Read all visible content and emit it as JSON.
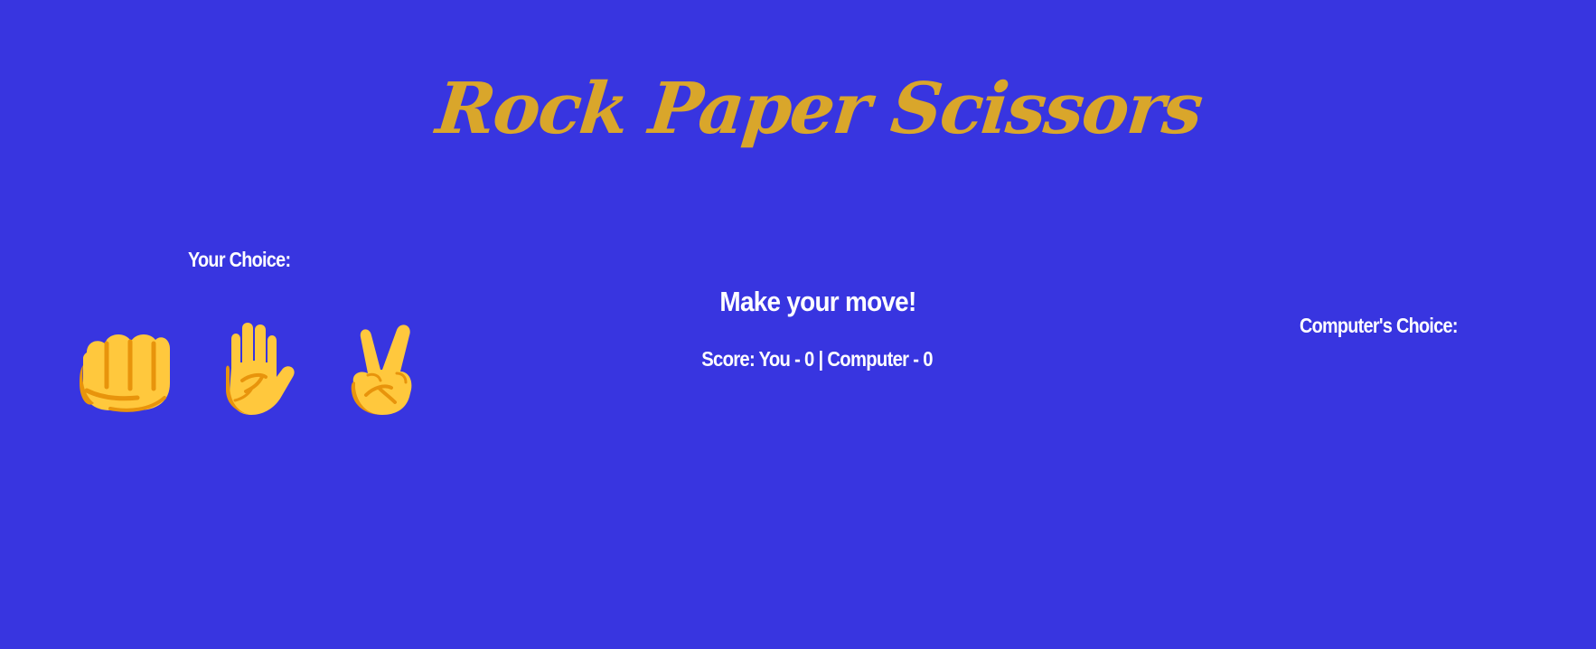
{
  "header": {
    "title": "Rock Paper Scissors"
  },
  "player": {
    "label": "Your Choice:",
    "choices": [
      {
        "name": "rock",
        "icon": "fist-icon"
      },
      {
        "name": "paper",
        "icon": "raised-hand-icon"
      },
      {
        "name": "scissors",
        "icon": "victory-hand-icon"
      }
    ]
  },
  "game": {
    "status": "Make your move!",
    "score": "Score: You - 0 | Computer - 0"
  },
  "computer": {
    "label": "Computer's Choice:"
  },
  "colors": {
    "background": "#3835e0",
    "title": "#d9a62b",
    "text": "#ffffff",
    "emoji_fill": "#ffc83d",
    "emoji_shade": "#e8940c"
  }
}
